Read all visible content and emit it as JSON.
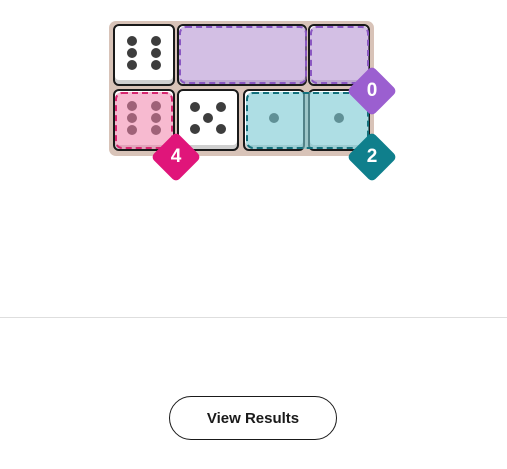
{
  "puzzle": {
    "dice": [
      {
        "pips": 6
      },
      {
        "pips": 0
      },
      {
        "pips": 0
      },
      {
        "pips": 0
      },
      {
        "pips": 6
      },
      {
        "pips": 5
      },
      {
        "pips": 1
      },
      {
        "pips": 1
      }
    ],
    "regions": [
      {
        "color": "purple",
        "target": ""
      },
      {
        "color": "purple",
        "target": "0"
      },
      {
        "color": "pink",
        "target": "4"
      },
      {
        "color": "teal",
        "target": "2"
      }
    ],
    "colors": {
      "purple": "#9b5fd0",
      "pink": "#e0157a",
      "teal": "#0f7f8c",
      "frame": "#d8c3b8"
    }
  },
  "footer": {
    "view_results_label": "View Results"
  }
}
